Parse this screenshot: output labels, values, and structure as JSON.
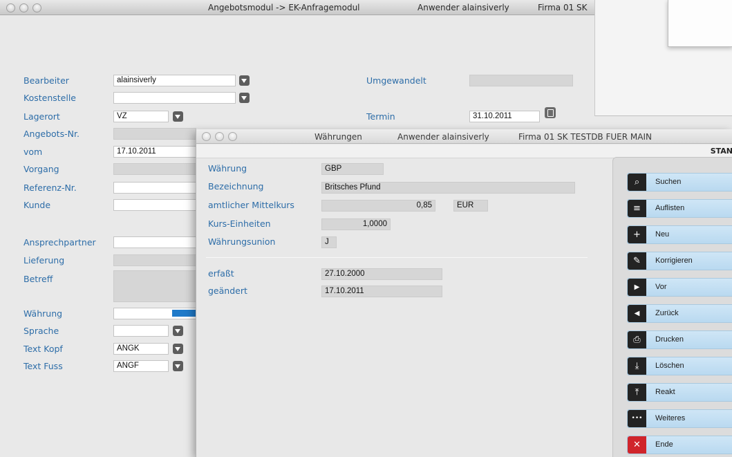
{
  "main_window": {
    "title": "Angebotsmodul -> EK-Anfragemodul",
    "user": "Anwender alainsiverly",
    "company": "Firma 01 SK"
  },
  "form": {
    "bearbeiter": {
      "label": "Bearbeiter",
      "value": "alainsiverly"
    },
    "kostenstelle": {
      "label": "Kostenstelle",
      "value": ""
    },
    "lagerort": {
      "label": "Lagerort",
      "value": "VZ"
    },
    "angebots_nr": {
      "label": "Angebots-Nr.",
      "value": ""
    },
    "vom": {
      "label": "vom",
      "value": "17.10.2011"
    },
    "vorgang": {
      "label": "Vorgang",
      "value": ""
    },
    "referenz_nr": {
      "label": "Referenz-Nr.",
      "value": ""
    },
    "kunde": {
      "label": "Kunde",
      "value": ""
    },
    "ansprechpartner": {
      "label": "Ansprechpartner",
      "value": ""
    },
    "lieferung": {
      "label": "Lieferung",
      "value": ""
    },
    "betreff": {
      "label": "Betreff",
      "value": ""
    },
    "waehrung": {
      "label": "Währung",
      "value": ""
    },
    "sprache": {
      "label": "Sprache",
      "value": ""
    },
    "text_kopf": {
      "label": "Text Kopf",
      "value": "ANGK"
    },
    "text_fuss": {
      "label": "Text Fuss",
      "value": "ANGF"
    },
    "umgewandelt": {
      "label": "Umgewandelt",
      "value": ""
    },
    "termin": {
      "label": "Termin",
      "value": "31.10.2011"
    }
  },
  "dialog": {
    "title": "Währungen",
    "user": "Anwender alainsiverly",
    "company": "Firma 01 SK TESTDB FUER MAIN",
    "status": "STAN",
    "fields": {
      "waehrung": {
        "label": "Währung",
        "value": "GBP"
      },
      "bezeichnung": {
        "label": "Bezeichnung",
        "value": "Britsches Pfund"
      },
      "mittelkurs": {
        "label": "amtlicher Mittelkurs",
        "value": "0,85",
        "currency": "EUR"
      },
      "kurs_einheiten": {
        "label": "Kurs-Einheiten",
        "value": "1,0000"
      },
      "waehrungsunion": {
        "label": "Währungsunion",
        "value": "J"
      },
      "erfasst": {
        "label": "erfaßt",
        "value": "27.10.2000"
      },
      "geaendert": {
        "label": "geändert",
        "value": "17.10.2011"
      }
    }
  },
  "actions": [
    {
      "label": "Suchen",
      "icon": "search-icon",
      "glyph": "⌕"
    },
    {
      "label": "Auflisten",
      "icon": "list-icon",
      "glyph": "≡"
    },
    {
      "label": "Neu",
      "icon": "plus-icon",
      "glyph": "+"
    },
    {
      "label": "Korrigieren",
      "icon": "pen-icon",
      "glyph": "✎"
    },
    {
      "label": "Vor",
      "icon": "play-right-icon",
      "glyph": "▶"
    },
    {
      "label": "Zurück",
      "icon": "play-left-icon",
      "glyph": "◀"
    },
    {
      "label": "Drucken",
      "icon": "printer-icon",
      "glyph": "⎙"
    },
    {
      "label": "Löschen",
      "icon": "delete-tray-icon",
      "glyph": "⤓"
    },
    {
      "label": "Reakt",
      "icon": "reactivate-tray-icon",
      "glyph": "⤒"
    },
    {
      "label": "Weiteres",
      "icon": "more-icon",
      "glyph": "•••"
    },
    {
      "label": "Ende",
      "icon": "close-icon",
      "glyph": "✕"
    }
  ],
  "colors": {
    "label_blue": "#2d6da8",
    "arrow_blue": "#1f7ac9",
    "action_button": "#c4e0f3",
    "end_red": "#d0252b"
  }
}
